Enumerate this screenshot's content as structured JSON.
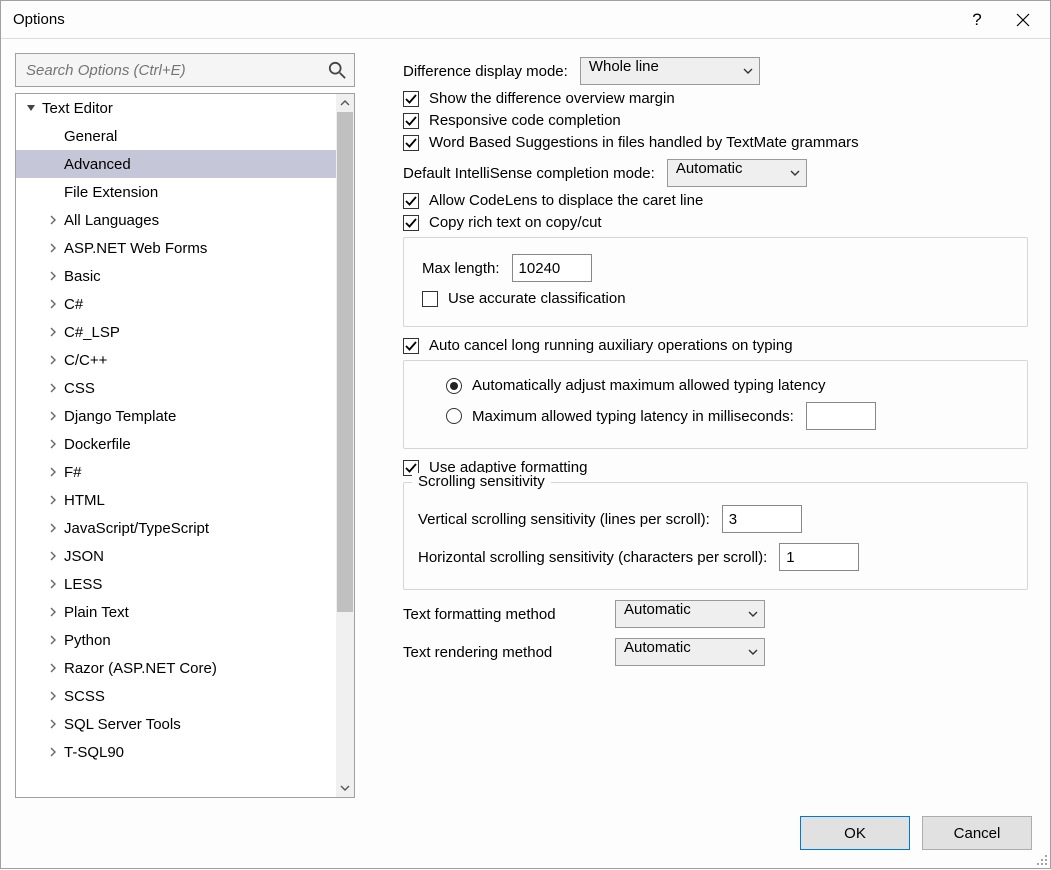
{
  "window": {
    "title": "Options"
  },
  "search": {
    "placeholder": "Search Options (Ctrl+E)"
  },
  "tree": {
    "root": "Text Editor",
    "items": [
      "General",
      "Advanced",
      "File Extension",
      "All Languages",
      "ASP.NET Web Forms",
      "Basic",
      "C#",
      "C#_LSP",
      "C/C++",
      "CSS",
      "Django Template",
      "Dockerfile",
      "F#",
      "HTML",
      "JavaScript/TypeScript",
      "JSON",
      "LESS",
      "Plain Text",
      "Python",
      "Razor (ASP.NET Core)",
      "SCSS",
      "SQL Server Tools",
      "T-SQL90"
    ],
    "selected": "Advanced",
    "plain_children": [
      "General",
      "Advanced",
      "File Extension"
    ]
  },
  "pane": {
    "diff_mode_label": "Difference display mode:",
    "diff_mode_value": "Whole line",
    "cb_overview": "Show the difference overview margin",
    "cb_responsive": "Responsive code completion",
    "cb_wordbased": "Word Based Suggestions in files handled by TextMate grammars",
    "intellisense_label": "Default IntelliSense completion mode:",
    "intellisense_value": "Automatic",
    "cb_codelens": "Allow CodeLens to displace the caret line",
    "cb_copyrich": "Copy rich text on copy/cut",
    "maxlen_label": "Max length:",
    "maxlen_value": "10240",
    "cb_accurate": "Use accurate classification",
    "cb_autocancel": "Auto cancel long running auxiliary operations on typing",
    "radio_auto": "Automatically adjust maximum allowed typing latency",
    "radio_max": "Maximum allowed typing latency in milliseconds:",
    "radio_max_value": "",
    "cb_adaptive": "Use adaptive formatting",
    "scroll_legend": "Scrolling sensitivity",
    "scroll_v_label": "Vertical scrolling sensitivity (lines per scroll):",
    "scroll_v_value": "3",
    "scroll_h_label": "Horizontal scrolling sensitivity (characters per scroll):",
    "scroll_h_value": "1",
    "fmt_label": "Text formatting method",
    "fmt_value": "Automatic",
    "render_label": "Text rendering method",
    "render_value": "Automatic"
  },
  "footer": {
    "ok": "OK",
    "cancel": "Cancel"
  }
}
